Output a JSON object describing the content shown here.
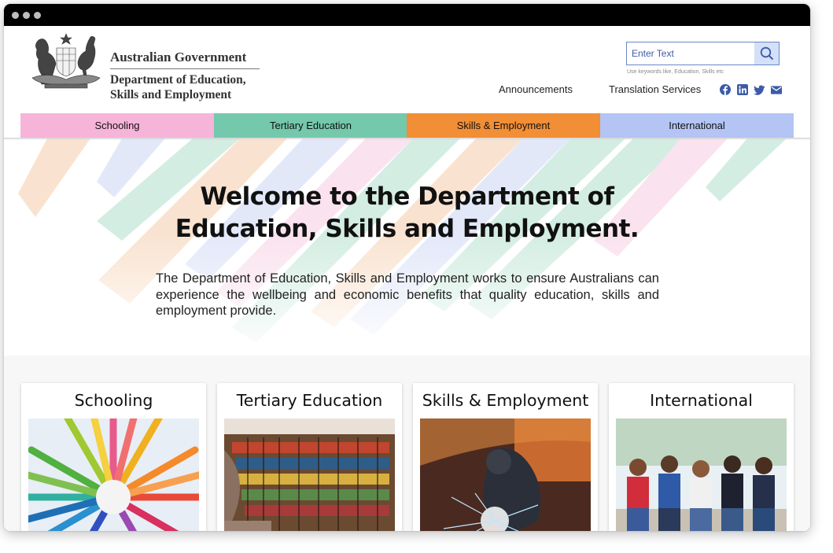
{
  "header": {
    "gov_name": "Australian Government",
    "dept_line1": "Department of Education,",
    "dept_line2": "Skills and Employment"
  },
  "search": {
    "placeholder": "Enter Text",
    "hint": "Use keywords like, Education, Skills etc"
  },
  "utility_links": [
    "Announcements",
    "Translation Services"
  ],
  "social_icons": [
    "facebook-icon",
    "linkedin-icon",
    "twitter-icon",
    "mail-icon"
  ],
  "nav": {
    "items": [
      {
        "label": "Schooling",
        "color": "#f7b4d9"
      },
      {
        "label": "Tertiary Education",
        "color": "#74c8ac"
      },
      {
        "label": "Skills & Employment",
        "color": "#f28e35"
      },
      {
        "label": "International",
        "color": "#b3c4f5"
      }
    ]
  },
  "hero": {
    "title_line1": "Welcome to the Department of",
    "title_line2": "Education, Skills and Employment.",
    "description": "The Department of Education, Skills and Employment works to ensure Australians can experience the wellbeing and economic benefits that quality education, skills and employment provide."
  },
  "cards": [
    {
      "title": "Schooling",
      "image": "colored-pencils-photo"
    },
    {
      "title": "Tertiary Education",
      "image": "library-bookshelves-photo"
    },
    {
      "title": "Skills & Employment",
      "image": "welder-sparks-photo"
    },
    {
      "title": "International",
      "image": "students-group-photo"
    }
  ]
}
